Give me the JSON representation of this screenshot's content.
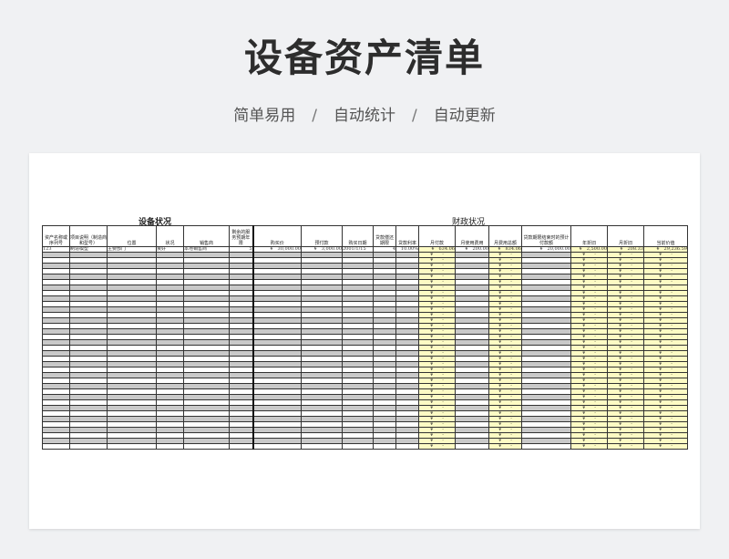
{
  "page": {
    "title": "设备资产清单",
    "tagline": [
      "简单易用",
      "自动统计",
      "自动更新"
    ],
    "separator": "/"
  },
  "sheet": {
    "section_equipment": "设备状况",
    "section_finance": "财政状况",
    "columns": [
      "资产名称或序列号",
      "项目说明（制造商和型号）",
      "位置",
      "状况",
      "销售商",
      "剩余的服务预期年限",
      "购买价",
      "预付款",
      "购买日期",
      "贷款偿还期限",
      "贷款利率",
      "月付款",
      "月使用费用",
      "月费用总额",
      "贷款期限结束时的预计付款额",
      "年折旧",
      "月折旧",
      "当前价值"
    ],
    "first_row": [
      "123",
      "制造模型",
      "主要部门",
      "良好",
      "本地销售商",
      "5",
      "¥　30,000.00",
      "¥　3,000.00",
      "2001/1/15",
      "4",
      "10.00%",
      "¥　634.06",
      "¥　200.00",
      "¥　834.06",
      "¥　20,000.00",
      "¥　2,500.00",
      "¥　208.33",
      "¥　29,236.59"
    ],
    "empty_formula_cell": "¥　　-",
    "empty_rows": 36
  }
}
